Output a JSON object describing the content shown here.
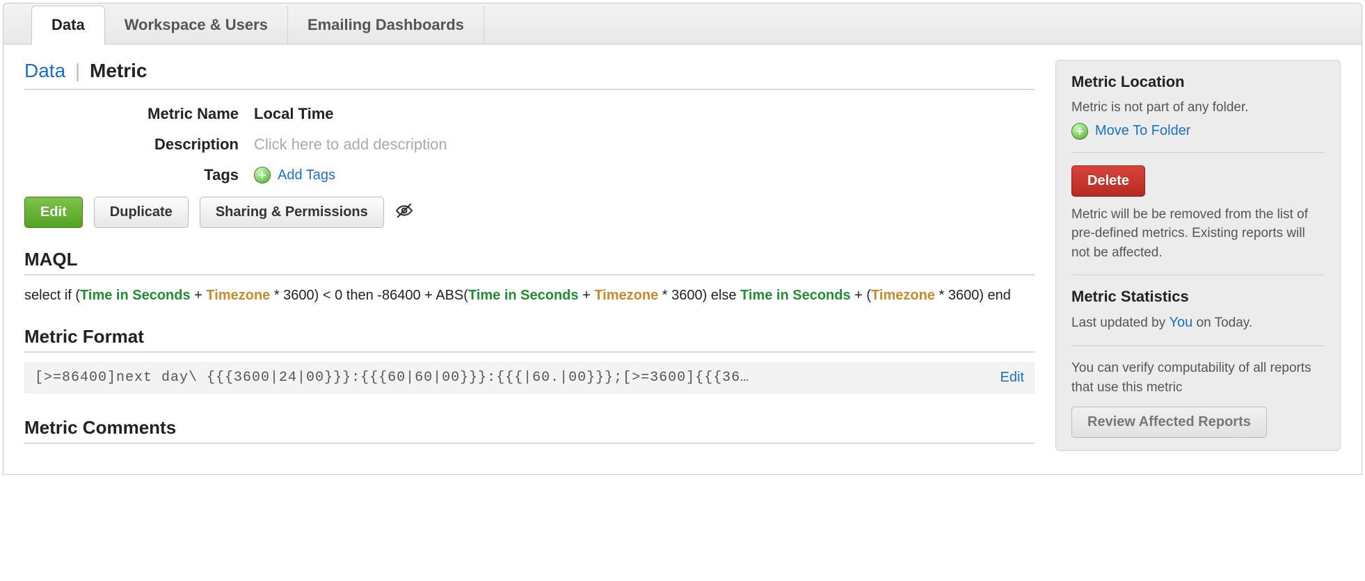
{
  "tabs": {
    "data": "Data",
    "workspace": "Workspace & Users",
    "emailing": "Emailing Dashboards"
  },
  "breadcrumb": {
    "root": "Data",
    "current": "Metric"
  },
  "metric": {
    "name_label": "Metric Name",
    "name_value": "Local Time",
    "description_label": "Description",
    "description_placeholder": "Click here to add description",
    "tags_label": "Tags",
    "add_tags": "Add Tags"
  },
  "actions": {
    "edit": "Edit",
    "duplicate": "Duplicate",
    "sharing": "Sharing & Permissions"
  },
  "maql": {
    "heading": "MAQL",
    "expr": {
      "p1": "select if (",
      "tis": "Time in Seconds",
      "plus": " + ",
      "tz": "Timezone",
      "p2": " * 3600) < 0 then -86400 + ABS(",
      "p3": " * 3600) else ",
      "p4": " + (",
      "p5": " * 3600) end"
    }
  },
  "format": {
    "heading": "Metric Format",
    "code": "[>=86400]next day\\ {{{3600|24|00}}}:{{{60|60|00}}}:{{{|60.|00}}};[>=3600]{{{36…",
    "edit": "Edit"
  },
  "comments": {
    "heading": "Metric Comments"
  },
  "side": {
    "location_heading": "Metric Location",
    "location_text": "Metric is not part of any folder.",
    "move": "Move To Folder",
    "delete": "Delete",
    "delete_note": "Metric will be be removed from the list of pre-defined metrics. Existing reports will not be affected.",
    "stats_heading": "Metric Statistics",
    "stats_prefix": "Last updated by ",
    "stats_who": "You",
    "stats_suffix": " on Today.",
    "verify_text": "You can verify computability of all reports that use this metric",
    "review": "Review Affected Reports"
  }
}
